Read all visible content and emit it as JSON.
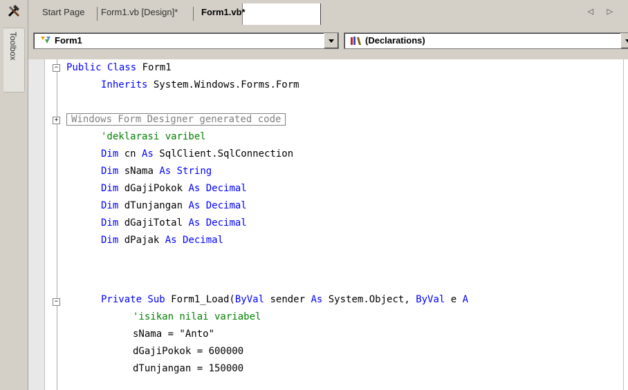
{
  "toolbox": {
    "label": "Toolbox"
  },
  "tabs": [
    {
      "label": "Start Page"
    },
    {
      "label": "Form1.vb [Design]*"
    },
    {
      "label": "Form1.vb*"
    }
  ],
  "nav_arrows": "◁ ▷",
  "class_combo": {
    "value": "Form1"
  },
  "member_combo": {
    "value": "(Declarations)"
  },
  "code": {
    "l1": [
      "Public Class",
      " Form1"
    ],
    "l2": [
      "Inherits",
      " System.Windows.Forms.Form"
    ],
    "l4": "Windows Form Designer generated code",
    "l5": "'deklarasi varibel",
    "l6": [
      "Dim",
      " cn ",
      "As",
      " SqlClient.SqlConnection"
    ],
    "l7": [
      "Dim",
      " sNama ",
      "As String",
      ""
    ],
    "l8": [
      "Dim",
      " dGajiPokok ",
      "As Decimal",
      ""
    ],
    "l9": [
      "Dim",
      " dTunjangan ",
      "As Decimal",
      ""
    ],
    "l10": [
      "Dim",
      " dGajiTotal ",
      "As Decimal",
      ""
    ],
    "l11": [
      "Dim",
      " dPajak ",
      "As Decimal",
      ""
    ],
    "l14": [
      "Private Sub",
      " Form1_Load(",
      "ByVal",
      " sender ",
      "As",
      " System.Object, ",
      "ByVal",
      " e ",
      "A"
    ],
    "l15": "'isikan nilai variabel",
    "l16": "sNama = \"Anto\"",
    "l17": "dGajiPokok = 600000",
    "l18": "dTunjangan = 150000"
  },
  "colors": {
    "keyword": "#0000ff",
    "comment": "#008000",
    "chrome": "#d4d0c8"
  }
}
